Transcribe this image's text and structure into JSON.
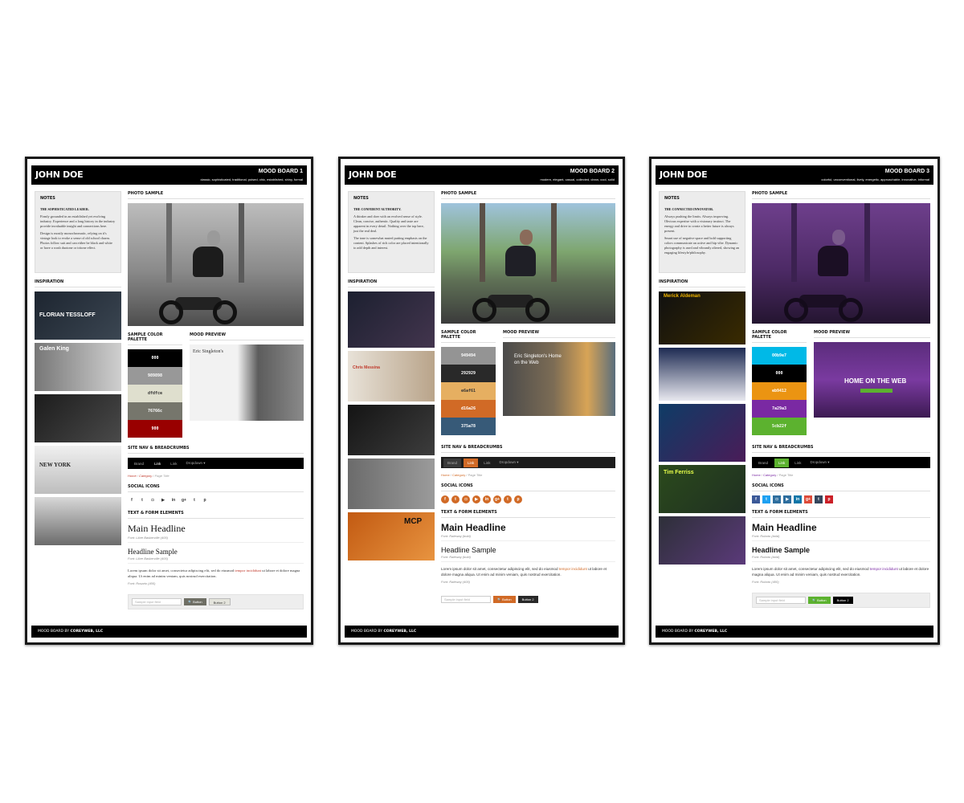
{
  "boards": [
    {
      "name": "JOHN DOE",
      "board_title": "MOOD BOARD 1",
      "subtitle": "classic, sophisticated, traditional, poised, chic, established, shiny, formal",
      "notes_title": "NOTES",
      "notes_sub": "THE SOPHISTICATED LEADER.",
      "notes_p1": "Firmly grounded in an established yet evolving industry. Experience and a long history in the industry provide invaluable insight and connections here.",
      "notes_p2": "Design is mostly monochromatic, relying on it's vintage look to evoke a sense of old school charm. Photos follow suit and can either be black and white or have a wash duotone or tritone effect.",
      "inspiration_title": "INSPIRATION",
      "thumb_labels": [
        "FLORIAN TESSLOFF",
        "Galen King",
        "",
        "NEW YORK",
        ""
      ],
      "photo_title": "PHOTO SAMPLE",
      "palette_title": "SAMPLE COLOR PALETTE",
      "preview_title": "MOOD PREVIEW",
      "palette": [
        {
          "hex": "000",
          "color": "#000000",
          "text": "#ffffff"
        },
        {
          "hex": "989898",
          "color": "#989898",
          "text": "#ffffff"
        },
        {
          "hex": "dfdfce",
          "color": "#dfdfce",
          "text": "#333333"
        },
        {
          "hex": "76766c",
          "color": "#76766c",
          "text": "#ffffff"
        },
        {
          "hex": "900",
          "color": "#990000",
          "text": "#ffffff"
        }
      ],
      "preview_text": "Eric Singleton's",
      "nav_title": "SITE NAV & BREADCRUMBS",
      "nav": {
        "brand": "Brand",
        "active": "Link",
        "link": "Link",
        "dropdown": "Dropdown ▾"
      },
      "crumbs": {
        "home": "Home",
        "category": "Category",
        "page": "Page Title"
      },
      "social_title": "SOCIAL ICONS",
      "social_icons": [
        "f",
        "t",
        "◘",
        "▶",
        "in",
        "g+",
        "t",
        "p"
      ],
      "text_title": "TEXT & FORM ELEMENTS",
      "main_headline": "Main Headline",
      "main_font": "Font: Libre Baskerville (400)",
      "headline_sample": "Headline Sample",
      "headline_font": "Font: Libre Baskerville (400)",
      "body": "Lorem ipsum dolor sit amet, consectetur adipiscing elit, sed do eiusmod",
      "body_highlight": "tempor incididunt",
      "body_rest": "ut labore et dolore magna aliqua. Ut enim ad minim veniam, quis nostrud exercitation.",
      "body_font": "Font: Rosario (400)",
      "input_placeholder": "Sample input field",
      "btn1": "🔍 Button",
      "btn2": "Button 2",
      "btn1_color": "#6f6f65",
      "btn2_color": "#e4e4dc",
      "accent": "#990000",
      "footer_label": "MOOD BOARD BY",
      "footer_brand": "COREYWEB, LLC"
    },
    {
      "name": "JOHN DOE",
      "board_title": "MOOD BOARD 2",
      "subtitle": "modern, elegant, casual, collected, clean, cool, solid",
      "notes_title": "NOTES",
      "notes_sub": "THE CONFIDENT AUTHORITY.",
      "notes_p1": "A thinker and doer with an evolved sense of style. Clean, concise, authentic. Quality and taste are apparent in every detail. Nothing over the top here, just the real deal.",
      "notes_p2": "The tone is somewhat muted putting emphasis on the content. Splashes of rich color are placed intentionally to add depth and interest.",
      "inspiration_title": "INSPIRATION",
      "thumb_labels": [
        "",
        "Chris Messina",
        "",
        "",
        "MCP"
      ],
      "photo_title": "PHOTO SAMPLE",
      "palette_title": "SAMPLE COLOR PALETTE",
      "preview_title": "MOOD PREVIEW",
      "palette": [
        {
          "hex": "949494",
          "color": "#949494",
          "text": "#ffffff"
        },
        {
          "hex": "292929",
          "color": "#292929",
          "text": "#ffffff"
        },
        {
          "hex": "e6af61",
          "color": "#e6af61",
          "text": "#333333"
        },
        {
          "hex": "d16a26",
          "color": "#d16a26",
          "text": "#ffffff"
        },
        {
          "hex": "375a78",
          "color": "#375a78",
          "text": "#ffffff"
        }
      ],
      "preview_text": "Eric Singleton's Home on the Web",
      "nav_title": "SITE NAV & BREADCRUMBS",
      "nav": {
        "brand": "Brand",
        "active": "Link",
        "link": "Link",
        "dropdown": "Dropdown ▾"
      },
      "crumbs": {
        "home": "Home",
        "category": "Category",
        "page": "Page Title"
      },
      "social_title": "SOCIAL ICONS",
      "social_icons": [
        "f",
        "t",
        "◘",
        "▶",
        "in",
        "g+",
        "t",
        "p"
      ],
      "text_title": "TEXT & FORM ELEMENTS",
      "main_headline": "Main Headline",
      "main_font": "Font: Raleway (bold)",
      "headline_sample": "Headline Sample",
      "headline_font": "Font: Raleway (bold)",
      "body": "Lorem ipsum dolor sit amet, consectetur adipiscing elit, sed do eiusmod",
      "body_highlight": "tempor incididunt",
      "body_rest": "ut labore et dolore magna aliqua. Ut enim ad minim veniam, quis nostrud exercitation.",
      "body_font": "Font: Raleway (400)",
      "input_placeholder": "Sample input field",
      "btn1": "🔍 Button",
      "btn2": "Button 2",
      "btn1_color": "#d16a26",
      "btn2_color": "#292929",
      "accent": "#d16a26",
      "footer_label": "MOOD BOARD BY",
      "footer_brand": "COREYWEB, LLC"
    },
    {
      "name": "JOHN DOE",
      "board_title": "MOOD BOARD 3",
      "subtitle": "colorful, unconventional, lively, energetic, approachable, innovative, informal",
      "notes_title": "NOTES",
      "notes_sub": "THE CONNECTED INNOVATOR.",
      "notes_p1": "Always pushing the limits. Always improving. Obvious expertise with a visionary instinct. The energy and drive to create a better future is always present.",
      "notes_p2": "Smart use of negative space and bold supporting colors communicate an active and hip vibe. Dynamic photography is used and vibrantly altered, showing an engaging lifestyle/philosophy.",
      "inspiration_title": "INSPIRATION",
      "thumb_labels": [
        "Merick Aldeman",
        "",
        "",
        "Tim Ferriss",
        ""
      ],
      "photo_title": "PHOTO SAMPLE",
      "palette_title": "SAMPLE COLOR PALETTE",
      "preview_title": "MOOD PREVIEW",
      "palette": [
        {
          "hex": "00b9e7",
          "color": "#00b9e7",
          "text": "#ffffff"
        },
        {
          "hex": "000",
          "color": "#000000",
          "text": "#ffffff"
        },
        {
          "hex": "eb9412",
          "color": "#eb9412",
          "text": "#ffffff"
        },
        {
          "hex": "7a29a3",
          "color": "#7a29a3",
          "text": "#ffffff"
        },
        {
          "hex": "5cb22f",
          "color": "#5cb22f",
          "text": "#ffffff"
        }
      ],
      "preview_text": "HOME ON THE WEB",
      "nav_title": "SITE NAV & BREADCRUMBS",
      "nav": {
        "brand": "Brand",
        "active": "Link",
        "link": "Link",
        "dropdown": "Dropdown ▾"
      },
      "crumbs": {
        "home": "Home",
        "category": "Category",
        "page": "Page Title"
      },
      "social_title": "SOCIAL ICONS",
      "social_icons": [
        "f",
        "t",
        "◘",
        "▶",
        "in",
        "g+",
        "t",
        "p"
      ],
      "text_title": "TEXT & FORM ELEMENTS",
      "main_headline": "Main Headline",
      "main_font": "Font: Roboto (bold)",
      "headline_sample": "Headline Sample",
      "headline_font": "Font: Roboto (bold)",
      "body": "Lorem ipsum dolor sit amet, consectetur adipiscing elit, sed do eiusmod",
      "body_highlight": "tempor incididunt",
      "body_rest": "ut labore et dolore magna aliqua. Ut enim ad minim veniam, quis nostrud exercitation.",
      "body_font": "Font: Roboto (400)",
      "input_placeholder": "Sample input field",
      "btn1": "🔍 Button",
      "btn2": "Button 2",
      "btn1_color": "#5cb22f",
      "btn2_color": "#000000",
      "accent": "#7a29a3",
      "footer_label": "MOOD BOARD BY",
      "footer_brand": "COREYWEB, LLC"
    }
  ]
}
